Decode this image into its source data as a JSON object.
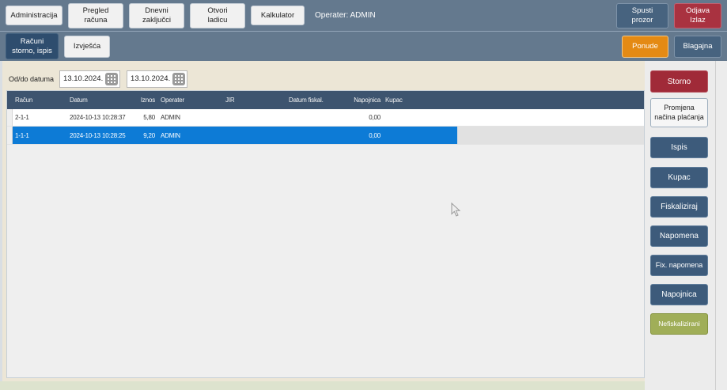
{
  "toolbar": {
    "items": [
      {
        "label": "Administracija"
      },
      {
        "label": "Pregled\nračuna"
      },
      {
        "label": "Dnevni\nzaključci"
      },
      {
        "label": "Otvori\nladicu"
      },
      {
        "label": "Kalkulator"
      }
    ],
    "operator": "Operater: ADMIN",
    "minimize": "Spusti\nprozor",
    "logout": "Odjava\nIzlaz"
  },
  "tabs": {
    "active": "Računi\nstorno, ispis",
    "reports": "Izvješća",
    "offers": "Ponude",
    "register": "Blagajna"
  },
  "filter": {
    "label": "Od/do datuma",
    "date_from": "13.10.2024.",
    "date_to": "13.10.2024."
  },
  "table": {
    "columns": [
      "Račun",
      "Datum",
      "Iznos",
      "Operater",
      "JIR",
      "Datum fiskal.",
      "Napojnica",
      "Kupac"
    ],
    "rows": [
      {
        "racun": "2-1-1",
        "datum": "2024-10-13 10:28:37",
        "iznos": "5,80",
        "operater": "ADMIN",
        "jir": "",
        "datum_fiskal": "",
        "napojnica": "0,00",
        "kupac": ""
      },
      {
        "racun": "1-1-1",
        "datum": "2024-10-13 10:28:25",
        "iznos": "9,20",
        "operater": "ADMIN",
        "jir": "",
        "datum_fiskal": "",
        "napojnica": "0,00",
        "kupac": ""
      }
    ],
    "selected_row_index": 1
  },
  "actions": {
    "storno": "Storno",
    "promjena": "Promjena\nnačina plaćanja",
    "ispis": "Ispis",
    "kupac": "Kupac",
    "fiskaliziraj": "Fiskaliziraj",
    "napomena": "Napomena",
    "fix_napomena": "Fix. napomena",
    "napojnica": "Napojnica",
    "nefiskalizirani": "Nefiskalizirani"
  },
  "colors": {
    "toolbar_bg": "#64798e",
    "active_tab": "#2e4d6e",
    "danger_red": "#a93240",
    "offers_orange": "#e48a14",
    "side_slate": "#3d5b7b",
    "olive_green": "#a0ae58",
    "grid_header": "#3d546f",
    "selected_row": "#0d7bd6",
    "content_beige": "#ece6d6",
    "bottom_strip": "#dde3ce"
  }
}
